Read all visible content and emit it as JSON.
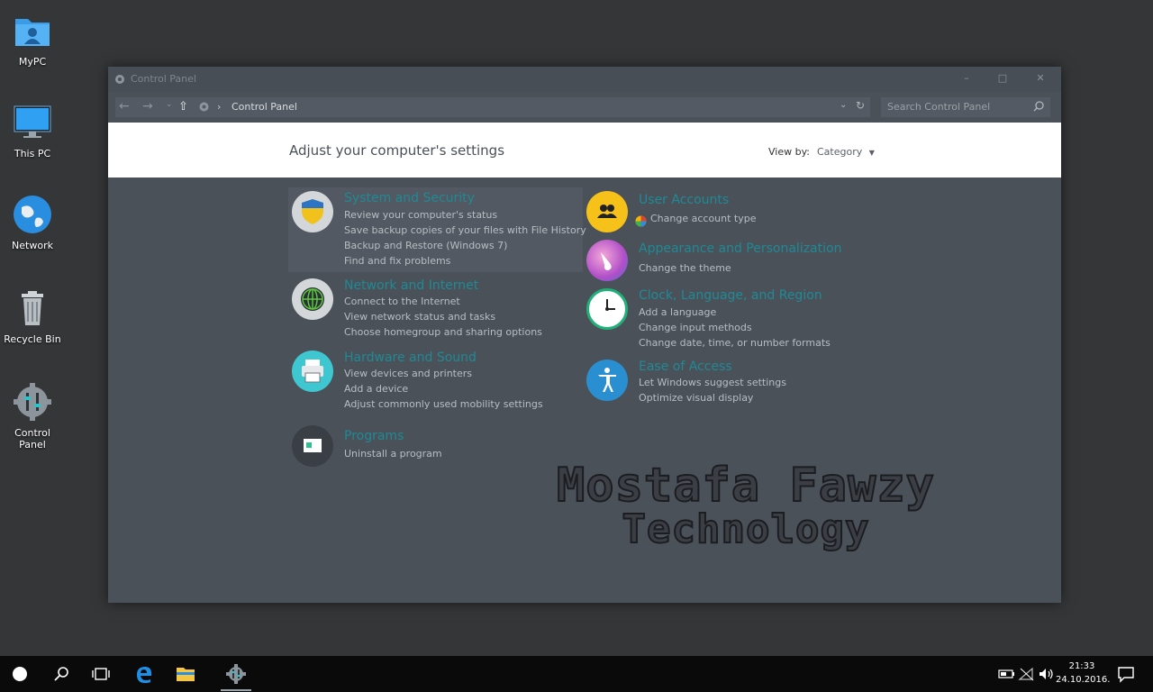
{
  "desktop": {
    "icons": [
      {
        "label": "MyPC"
      },
      {
        "label": "This PC"
      },
      {
        "label": "Network"
      },
      {
        "label": "Recycle Bin"
      },
      {
        "label": "Control\nPanel"
      }
    ]
  },
  "window": {
    "title": "Control Panel",
    "minimize_icon": "minimize-icon",
    "maximize_icon": "maximize-icon",
    "close_icon": "close-icon",
    "address": {
      "path_separator": "›",
      "current": "Control Panel"
    },
    "search": {
      "placeholder": "Search Control Panel"
    },
    "header": {
      "heading": "Adjust your computer's settings",
      "view_by_label": "View by:",
      "view_by_value": "Category"
    },
    "categories": [
      {
        "title": "System and Security",
        "links": [
          "Review your computer's status",
          "Save backup copies of your files with File History",
          "Backup and Restore (Windows 7)",
          "Find and fix problems"
        ]
      },
      {
        "title": "Network and Internet",
        "links": [
          "Connect to the Internet",
          "View network status and tasks",
          "Choose homegroup and sharing options"
        ]
      },
      {
        "title": "Hardware and Sound",
        "links": [
          "View devices and printers",
          "Add a device",
          "Adjust commonly used mobility settings"
        ]
      },
      {
        "title": "Programs",
        "links": [
          "Uninstall a program"
        ]
      },
      {
        "title": "User Accounts",
        "links": [
          "Change account type"
        ]
      },
      {
        "title": "Appearance and Personalization",
        "links": [
          "Change the theme"
        ]
      },
      {
        "title": "Clock, Language, and Region",
        "links": [
          "Add a language",
          "Change input methods",
          "Change date, time, or number formats"
        ]
      },
      {
        "title": "Ease of Access",
        "links": [
          "Let Windows suggest settings",
          "Optimize visual display"
        ]
      }
    ]
  },
  "watermark": {
    "line1": "Mostafa Fawzy",
    "line2": "Technology"
  },
  "taskbar": {
    "time": "21:33",
    "date": "24.10.2016."
  }
}
